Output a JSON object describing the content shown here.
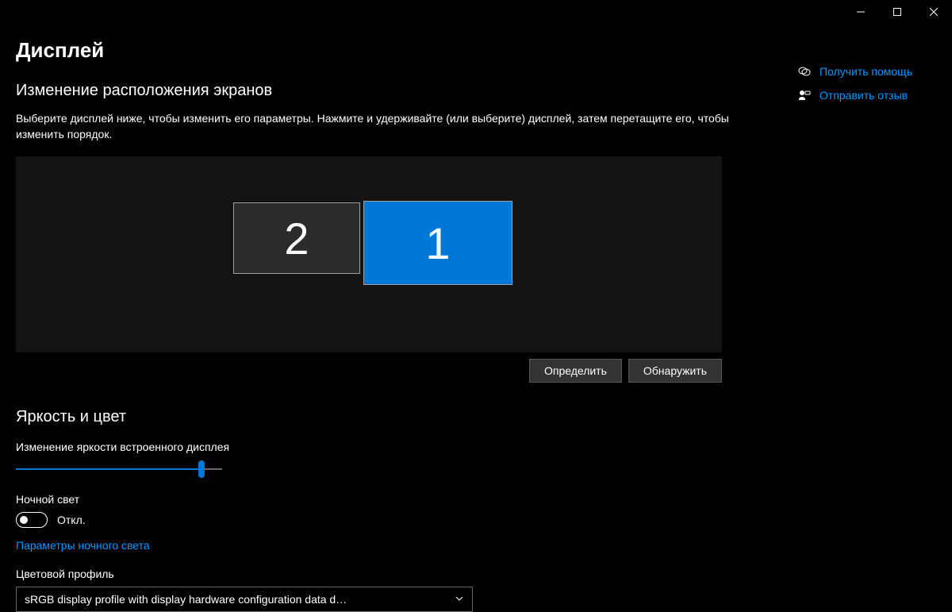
{
  "window": {
    "title": "Дисплей"
  },
  "arrange": {
    "heading": "Изменение расположения экранов",
    "hint": "Выберите дисплей ниже, чтобы изменить его параметры. Нажмите и удерживайте (или выберите) дисплей, затем перетащите его, чтобы изменить порядок.",
    "identify_btn": "Определить",
    "detect_btn": "Обнаружить",
    "monitors": {
      "primary": "1",
      "secondary": "2"
    }
  },
  "brightness": {
    "heading": "Яркость и цвет",
    "slider_label": "Изменение яркости встроенного дисплея",
    "slider_percent": 90
  },
  "night_light": {
    "label": "Ночной свет",
    "state": "Откл.",
    "settings_link": "Параметры ночного света"
  },
  "color_profile": {
    "label": "Цветовой профиль",
    "value": "sRGB display profile with display hardware configuration data d…"
  },
  "side": {
    "help": "Получить помощь",
    "feedback": "Отправить отзыв"
  }
}
